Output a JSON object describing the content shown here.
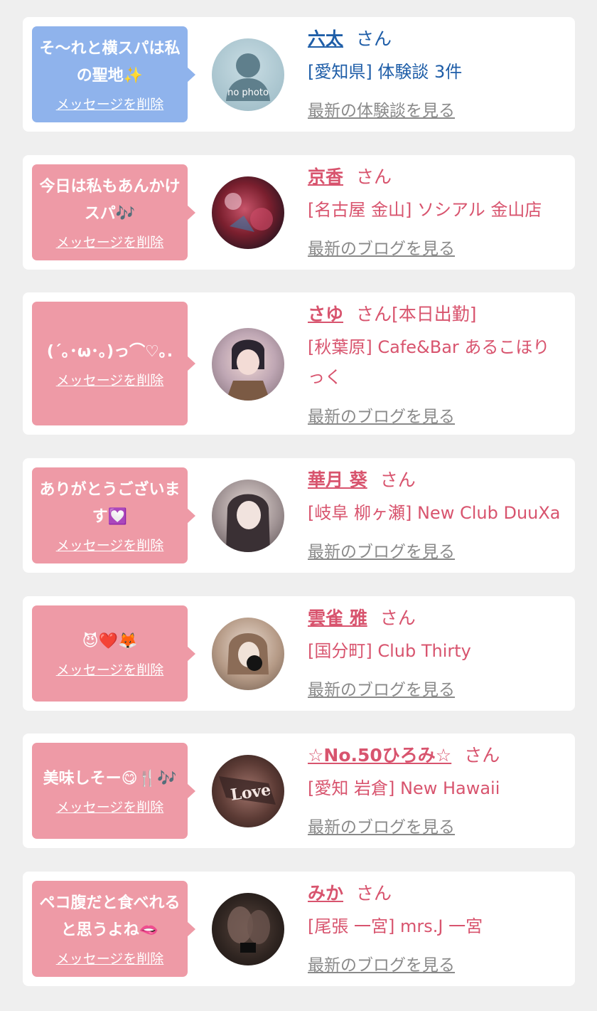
{
  "delete_label": "メッセージを削除",
  "colors": {
    "blue_bubble": "#8fb3ec",
    "pink_bubble": "#ee9aa6",
    "blue_text": "#1f5ea8",
    "pink_text": "#d8546e"
  },
  "items": [
    {
      "message": "そ〜れと横スパは私の聖地✨",
      "name": "六太",
      "suffix": "さん",
      "shop": "[愛知県] 体験談 3件",
      "link": "最新の体験談を見る",
      "avatar_label": "no photo",
      "icon": "no-photo-icon"
    },
    {
      "message": "今日は私もあんかけスパ🎶",
      "name": "京香",
      "suffix": "さん",
      "shop": "[名古屋 金山] ソシアル 金山店",
      "link": "最新のブログを見る"
    },
    {
      "message": "(´｡･ω･｡)っ⌒♡｡.",
      "name": "さゆ",
      "suffix": "さん[本日出勤]",
      "shop": "[秋葉原] Cafe&Bar あるこほりっく",
      "link": "最新のブログを見る"
    },
    {
      "message": "ありがとうございます💟",
      "name": "華月 葵",
      "suffix": "さん",
      "shop": "[岐阜 柳ヶ瀬] New Club DuuXa",
      "link": "最新のブログを見る"
    },
    {
      "message": "😈❤️🦊",
      "name": "雲雀 雅",
      "suffix": "さん",
      "shop": "[国分町] Club Thirty",
      "link": "最新のブログを見る"
    },
    {
      "message": "美味しそー😋🍴🎶",
      "name": "☆No.50ひろみ☆",
      "suffix": "さん",
      "shop": "[愛知 岩倉] New Hawaii",
      "link": "最新のブログを見る"
    },
    {
      "message": "ペコ腹だと食べれると思うよね🫦",
      "name": "みか",
      "suffix": "さん",
      "shop": "[尾張 一宮] mrs.J 一宮",
      "link": "最新のブログを見る"
    }
  ]
}
